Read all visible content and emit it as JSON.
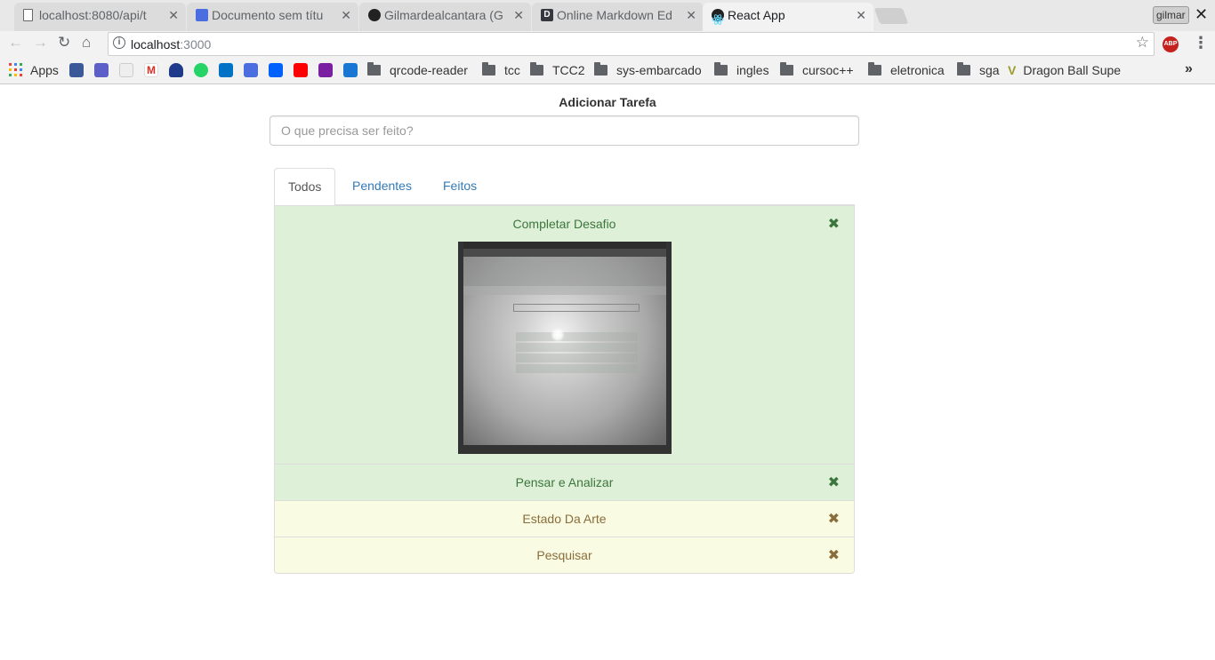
{
  "browser": {
    "tabs": [
      {
        "title": "localhost:8080/api/t",
        "favicon": "page-icon",
        "active": false
      },
      {
        "title": "Documento sem títu",
        "favicon": "docs-icon",
        "active": false
      },
      {
        "title": "Gilmardealcantara (G",
        "favicon": "github-icon",
        "active": false
      },
      {
        "title": "Online Markdown Ed",
        "favicon": "dillinger-icon",
        "active": false
      },
      {
        "title": "React App",
        "favicon": "react-icon",
        "active": true
      }
    ],
    "profile_name": "gilmar",
    "url_host": "localhost",
    "url_port": ":3000",
    "extension_label": "ABP",
    "bookmarks": {
      "apps_label": "Apps",
      "folders": [
        "qrcode-reader",
        "tcc",
        "TCC2",
        "sys-embarcado",
        "ingles",
        "cursoc++",
        "eletronica",
        "sga"
      ],
      "link": "Dragon Ball Supe"
    }
  },
  "todo": {
    "add_title": "Adicionar Tarefa",
    "input_placeholder": "O que precisa ser feito?",
    "tabs": [
      "Todos",
      "Pendentes",
      "Feitos"
    ],
    "active_tab": "Todos",
    "items": [
      {
        "label": "Completar Desafio",
        "status": "done",
        "has_image": true
      },
      {
        "label": "Pensar e Analizar",
        "status": "done",
        "has_image": false
      },
      {
        "label": "Estado Da Arte",
        "status": "pending",
        "has_image": false
      },
      {
        "label": "Pesquisar",
        "status": "pending",
        "has_image": false
      }
    ],
    "delete_icon": "✖"
  },
  "colors": {
    "done_bg": "#dff0d8",
    "done_text": "#3c763d",
    "pending_bg": "#f9fbe3",
    "pending_text": "#8a6d3b",
    "link": "#337ab7"
  }
}
